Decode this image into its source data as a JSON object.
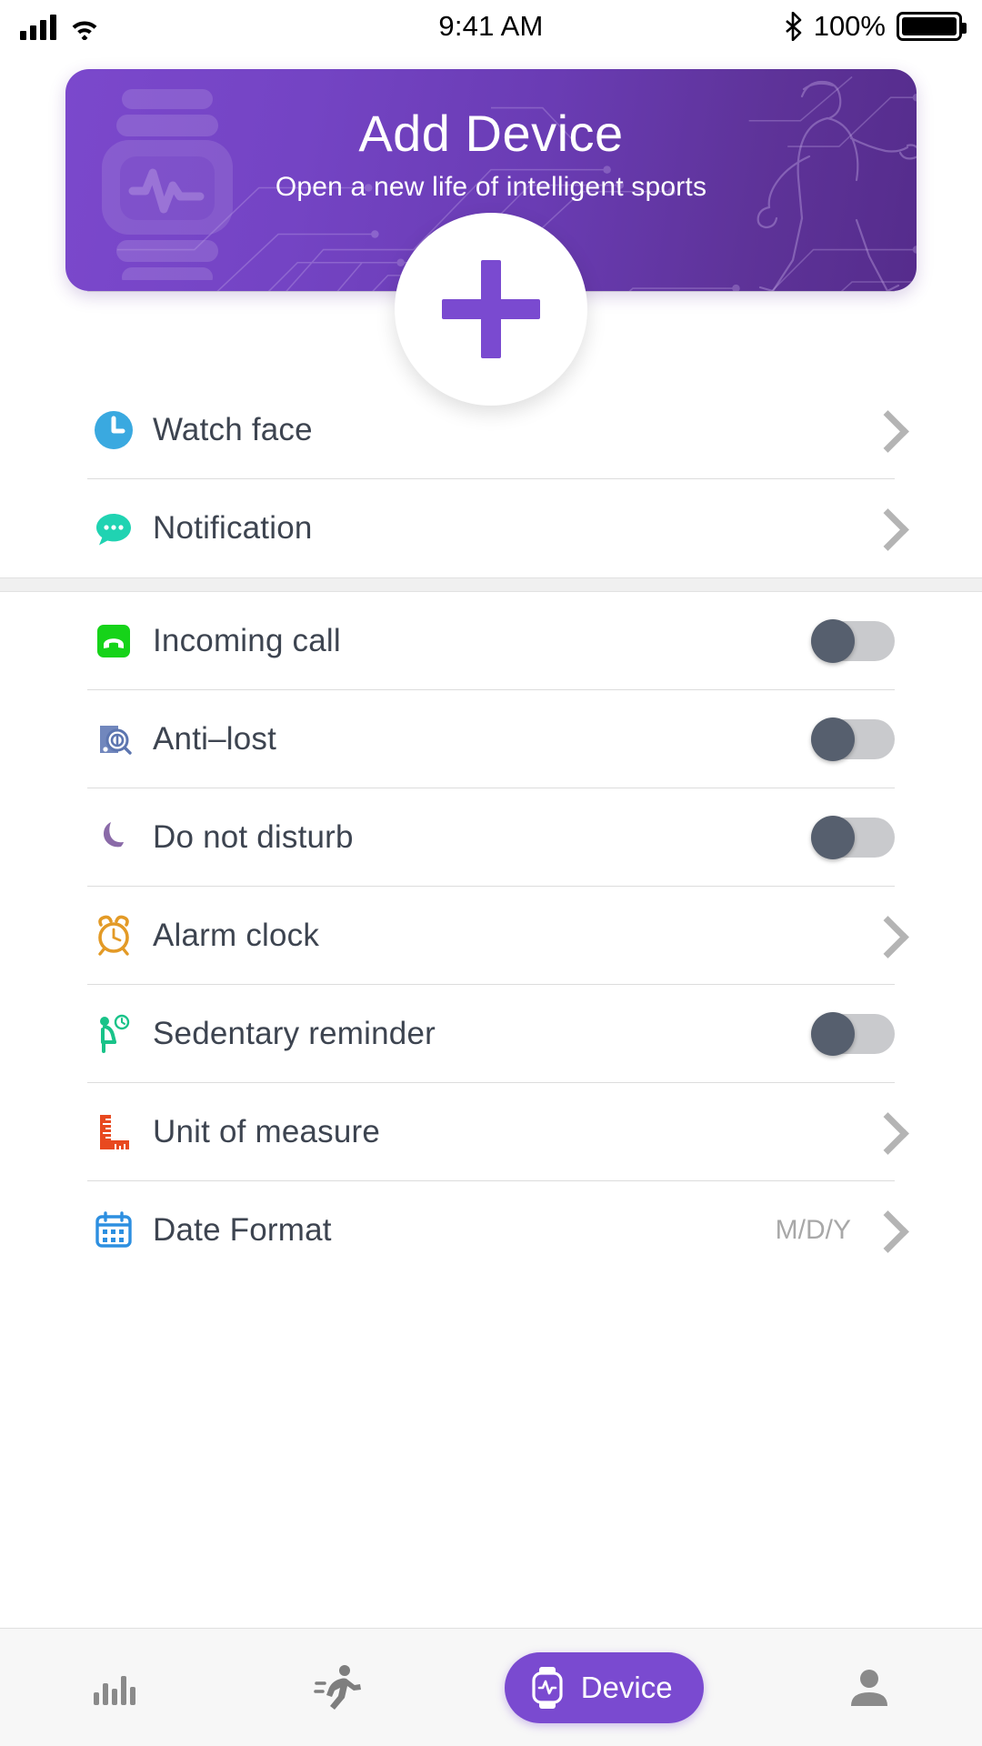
{
  "status_bar": {
    "time": "9:41 AM",
    "battery_percent": "100%",
    "icons": [
      "signal-bars-icon",
      "wifi-icon",
      "bluetooth-icon",
      "battery-icon"
    ]
  },
  "banner": {
    "title": "Add Device",
    "subtitle": "Open a new life of intelligent sports",
    "add_button_icon": "plus-icon",
    "gradient_from": "#7b48cc",
    "gradient_to": "#552c8c",
    "accent": "#7a4ad0"
  },
  "sections": [
    {
      "id": "display-section",
      "rows": [
        {
          "label": "Watch face",
          "icon": "clock-icon",
          "icon_color": "#3aa9e0",
          "control": "chevron"
        },
        {
          "label": "Notification",
          "icon": "speech-bubble-icon",
          "icon_color": "#20d3b2",
          "control": "chevron"
        }
      ]
    },
    {
      "id": "settings-section",
      "rows": [
        {
          "label": "Incoming call",
          "icon": "phone-icon",
          "icon_color": "#16d319",
          "control": "toggle",
          "toggle_on": false
        },
        {
          "label": "Anti–lost",
          "icon": "anti-lost-icon",
          "icon_color": "#7187bd",
          "control": "toggle",
          "toggle_on": false
        },
        {
          "label": "Do not disturb",
          "icon": "moon-icon",
          "icon_color": "#8a6aa8",
          "control": "toggle",
          "toggle_on": false
        },
        {
          "label": "Alarm clock",
          "icon": "alarm-clock-icon",
          "icon_color": "#e39a26",
          "control": "chevron"
        },
        {
          "label": "Sedentary reminder",
          "icon": "sedentary-icon",
          "icon_color": "#19c389",
          "control": "toggle",
          "toggle_on": false
        },
        {
          "label": "Unit of measure",
          "icon": "ruler-icon",
          "icon_color": "#e8491f",
          "control": "chevron"
        },
        {
          "label": "Date Format",
          "icon": "calendar-icon",
          "icon_color": "#2d8fe0",
          "control": "chevron",
          "value": "M/D/Y"
        }
      ]
    }
  ],
  "tabbar": {
    "items": [
      {
        "id": "stats",
        "label": "",
        "icon": "bar-chart-icon",
        "active": false
      },
      {
        "id": "sport",
        "label": "",
        "icon": "running-icon",
        "active": false
      },
      {
        "id": "device",
        "label": "Device",
        "icon": "watch-icon",
        "active": true
      },
      {
        "id": "profile",
        "label": "",
        "icon": "person-icon",
        "active": false
      }
    ],
    "active_color": "#7a4ad0"
  }
}
